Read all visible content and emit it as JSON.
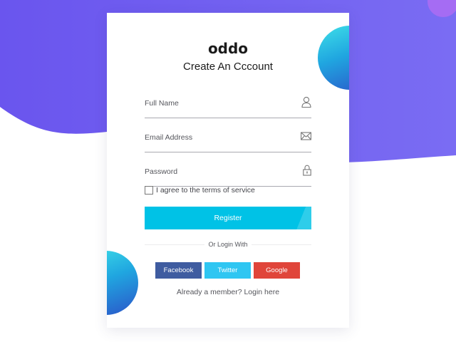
{
  "brand": {
    "name": "oddo"
  },
  "form": {
    "title": "Create An Cccount",
    "fields": [
      {
        "label": "Full Name",
        "icon": "user-icon"
      },
      {
        "label": "Email Address",
        "icon": "envelope-icon"
      },
      {
        "label": "Password",
        "icon": "lock-icon"
      }
    ],
    "terms": {
      "label": "I agree to the terms of service",
      "checked": false
    },
    "register_label": "Register",
    "divider_text": "Or Login With",
    "social": [
      {
        "label": "Facebook",
        "color": "#3f5ca0"
      },
      {
        "label": "Twitter",
        "color": "#2fc6f2"
      },
      {
        "label": "Google",
        "color": "#e0453a"
      }
    ],
    "login_link": "Already a member? Login here"
  },
  "colors": {
    "accent": "#00c2e6",
    "background_wave": "#6e5ff0",
    "circle_gradient": [
      "#3ee0e8",
      "#20a6e0",
      "#2b55c9"
    ]
  }
}
